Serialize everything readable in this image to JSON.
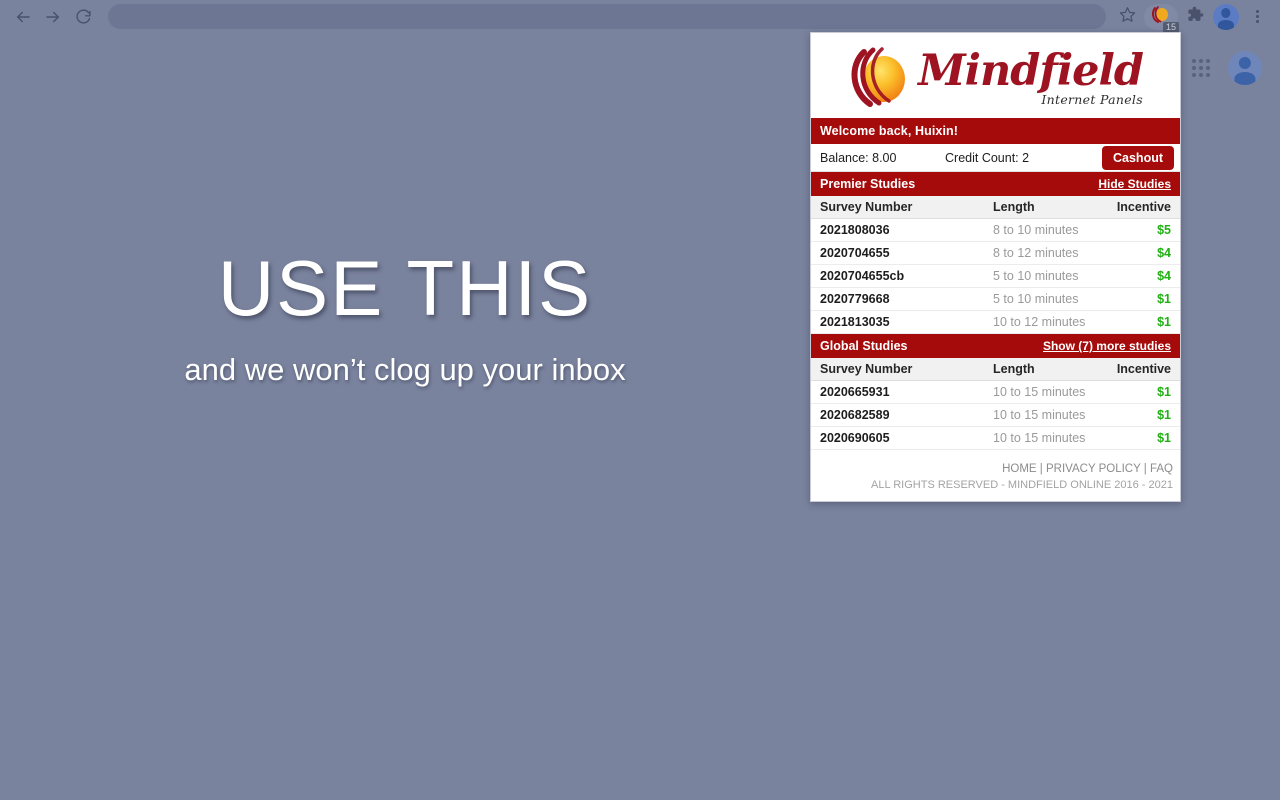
{
  "browser": {
    "back_icon": "back-arrow-icon",
    "forward_icon": "forward-arrow-icon",
    "reload_icon": "reload-icon",
    "omnibox_value": "",
    "omnibox_placeholder": "",
    "bookmark_icon": "star-icon",
    "extension_icon": "mindfield-extension-icon",
    "extension_badge": "15",
    "extensions_icon": "puzzle-piece-icon",
    "profile_icon": "profile-avatar-icon",
    "menu_icon": "three-dot-menu-icon"
  },
  "page": {
    "apps_icon": "google-apps-grid-icon",
    "account_icon": "account-avatar-icon",
    "hero_title": "USE THIS",
    "hero_subtitle": "and we won’t clog up your inbox"
  },
  "popup": {
    "logo_wordmark": "Mindfield",
    "logo_tagline": "Internet Panels",
    "logo_icon": "mindfield-globe-logo",
    "welcome_message": "Welcome back, Huixin!",
    "balance_label": "Balance: 8.00",
    "credit_label": "Credit Count: 2",
    "cashout_label": "Cashout",
    "columns": {
      "survey": "Survey Number",
      "length": "Length",
      "incentive": "Incentive"
    },
    "premier": {
      "title": "Premier Studies",
      "action": "Hide Studies",
      "rows": [
        {
          "survey": "2021808036",
          "length": "8 to 10 minutes",
          "incentive": "$5"
        },
        {
          "survey": "2020704655",
          "length": "8 to 12 minutes",
          "incentive": "$4"
        },
        {
          "survey": "2020704655cb",
          "length": "5 to 10 minutes",
          "incentive": "$4"
        },
        {
          "survey": "2020779668",
          "length": "5 to 10 minutes",
          "incentive": "$1"
        },
        {
          "survey": "2021813035",
          "length": "10 to 12 minutes",
          "incentive": "$1"
        }
      ]
    },
    "global": {
      "title": "Global Studies",
      "action": "Show (7) more studies",
      "rows": [
        {
          "survey": "2020665931",
          "length": "10 to 15 minutes",
          "incentive": "$1"
        },
        {
          "survey": "2020682589",
          "length": "10 to 15 minutes",
          "incentive": "$1"
        },
        {
          "survey": "2020690605",
          "length": "10 to 15 minutes",
          "incentive": "$1"
        }
      ]
    },
    "footer": {
      "home": "HOME",
      "sep1": " | ",
      "privacy": "PRIVACY POLICY",
      "sep2": " | ",
      "faq": "FAQ",
      "copyright": "ALL RIGHTS RESERVED - MINDFIELD ONLINE 2016 - 2021"
    }
  },
  "colors": {
    "brand_red": "#a50b0b",
    "logo_red": "#9e1321",
    "incentive_green": "#22b014",
    "chrome_bg": "#7a839e"
  }
}
